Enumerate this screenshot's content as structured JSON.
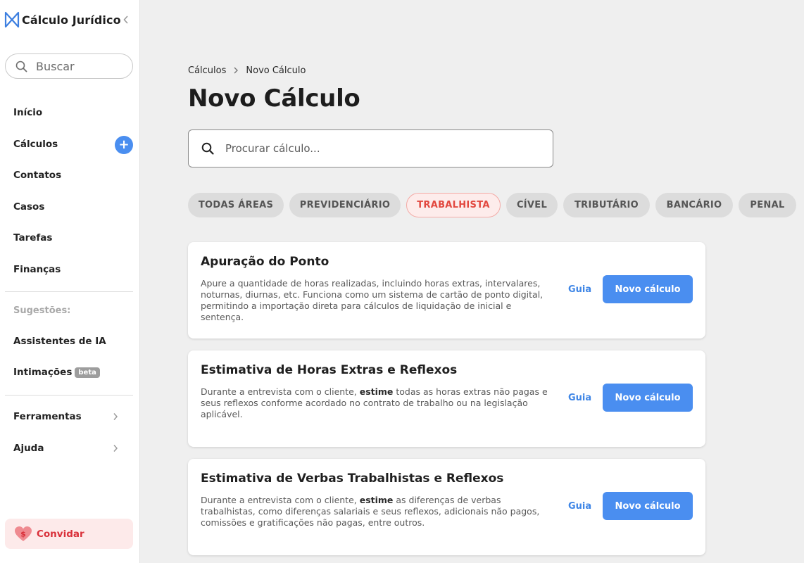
{
  "brand": {
    "name": "Cálculo Jurídico"
  },
  "sidebar": {
    "search_placeholder": "Buscar",
    "items": [
      {
        "label": "Início"
      },
      {
        "label": "Cálculos"
      },
      {
        "label": "Contatos"
      },
      {
        "label": "Casos"
      },
      {
        "label": "Tarefas"
      },
      {
        "label": "Finanças"
      }
    ],
    "suggestions_label": "Sugestões:",
    "suggestions": [
      {
        "label": "Assistentes de IA"
      },
      {
        "label": "Intimações",
        "badge": "beta"
      }
    ],
    "tools": [
      {
        "label": "Ferramentas"
      },
      {
        "label": "Ajuda"
      }
    ],
    "invite_label": "Convidar",
    "add_symbol": "+"
  },
  "breadcrumb": {
    "root": "Cálculos",
    "current": "Novo Cálculo"
  },
  "page": {
    "title": "Novo Cálculo",
    "search_placeholder": "Procurar cálculo..."
  },
  "filters": [
    {
      "label": "TODAS ÁREAS",
      "active": false
    },
    {
      "label": "PREVIDENCIÁRIO",
      "active": false
    },
    {
      "label": "TRABALHISTA",
      "active": true
    },
    {
      "label": "CÍVEL",
      "active": false
    },
    {
      "label": "TRIBUTÁRIO",
      "active": false
    },
    {
      "label": "BANCÁRIO",
      "active": false
    },
    {
      "label": "PENAL",
      "active": false
    }
  ],
  "cards": [
    {
      "title": "Apuração do Ponto",
      "desc_pre": "Apure a quantidade de horas realizadas, incluindo horas extras, intervalares, noturnas, diurnas, etc. Funciona como um sistema de cartão de ponto digital, permitindo a importação direta para cálculos de liquidação de inicial e sentença.",
      "desc_bold": "",
      "desc_post": "",
      "guide_label": "Guia",
      "button_label": "Novo cálculo"
    },
    {
      "title": "Estimativa de Horas Extras e Reflexos",
      "desc_pre": "Durante a entrevista com o cliente, ",
      "desc_bold": "estime",
      "desc_post": " todas as horas extras não pagas e seus reflexos conforme acordado no contrato de trabalho ou na legislação aplicável.",
      "guide_label": "Guia",
      "button_label": "Novo cálculo"
    },
    {
      "title": "Estimativa de Verbas Trabalhistas e Reflexos",
      "desc_pre": "Durante a entrevista com o cliente, ",
      "desc_bold": "estime",
      "desc_post": " as diferenças de verbas trabalhistas, como diferenças salariais e seus reflexos, adicionais não pagos, comissões e gratificações não pagas, entre outros.",
      "guide_label": "Guia",
      "button_label": "Novo cálculo"
    }
  ],
  "colors": {
    "accent": "#4a8ef0",
    "active_chip_text": "#e2483f",
    "active_chip_bg": "#fdeceb",
    "invite_text": "#d9303a",
    "invite_bg": "#fdeaea"
  },
  "icons": {
    "logo": "brand-logo-icon",
    "collapse": "chevron-left-icon",
    "search": "search-icon",
    "add": "plus-icon",
    "expand": "chevron-right-icon",
    "invite": "heart-dollar-icon"
  }
}
